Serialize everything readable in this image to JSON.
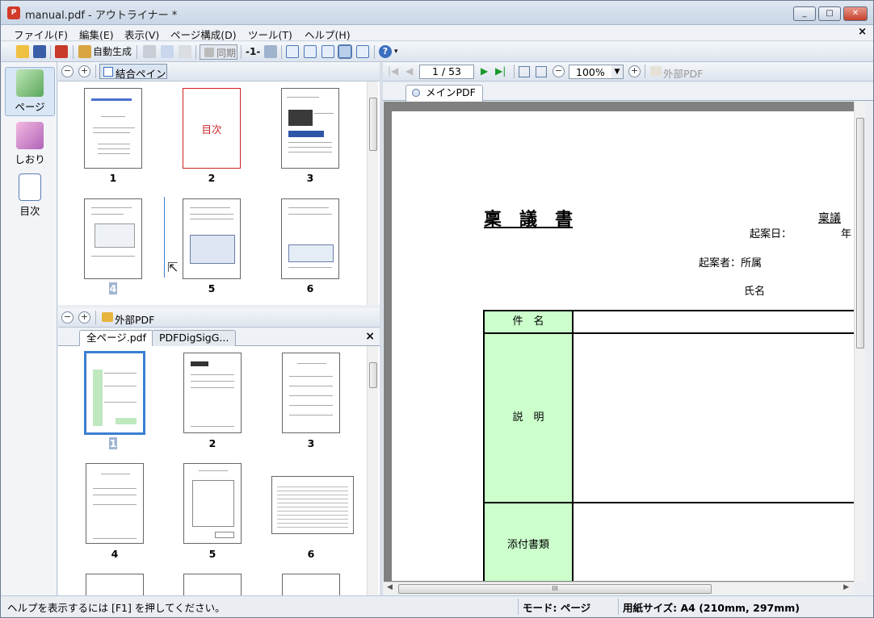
{
  "window": {
    "title": "manual.pdf - アウトライナー *",
    "app_icon": "pdf-app-icon",
    "min": "_",
    "max": "□",
    "close": "✕"
  },
  "menu": {
    "items": [
      "ファイル(F)",
      "編集(E)",
      "表示(V)",
      "ページ構成(D)",
      "ツール(T)",
      "ヘルプ(H)"
    ],
    "close": "×"
  },
  "toolbar": {
    "auto_generate": "自動生成",
    "sync": "同期",
    "page_indicator": "-1-",
    "help": "?"
  },
  "leftnav": {
    "items": [
      {
        "label": "ページ",
        "icon": "pages-icon"
      },
      {
        "label": "しおり",
        "icon": "bookmark-icon"
      },
      {
        "label": "目次",
        "icon": "toc-icon"
      }
    ]
  },
  "top_pane": {
    "combine_label": "結合ペイン",
    "thumbs": [
      {
        "num": "1"
      },
      {
        "num": "2",
        "label": "目次"
      },
      {
        "num": "3"
      },
      {
        "num": "4"
      },
      {
        "num": "5"
      },
      {
        "num": "6"
      }
    ]
  },
  "bottom_pane": {
    "external_pdf": "外部PDF",
    "tabs": [
      "全ページ.pdf",
      "PDFDigSigG..."
    ],
    "close": "×",
    "thumbs": [
      {
        "num": "1"
      },
      {
        "num": "2"
      },
      {
        "num": "3"
      },
      {
        "num": "4"
      },
      {
        "num": "5"
      },
      {
        "num": "6"
      }
    ]
  },
  "viewer": {
    "page_input": "1 / 53",
    "zoom": "100%",
    "external_pdf": "外部PDF",
    "tab": "メインPDF",
    "scroll_grip": "III"
  },
  "document": {
    "title": "稟　議　書",
    "ringi": "稟議",
    "kian_date": "起案日：",
    "year": "年",
    "kian_sha": "起案者：所属",
    "shimei": "氏名",
    "rows": [
      "件　名",
      "説　明",
      "添付書類"
    ]
  },
  "status": {
    "help": "ヘルプを表示するには [F1] を押してください。",
    "mode": "モード: ページ",
    "paper": "用紙サイズ: A4 (210mm, 297mm)"
  },
  "colors": {
    "accent": "#3b7fd1",
    "green_cell": "#ccffcc",
    "red": "#cc2222"
  }
}
